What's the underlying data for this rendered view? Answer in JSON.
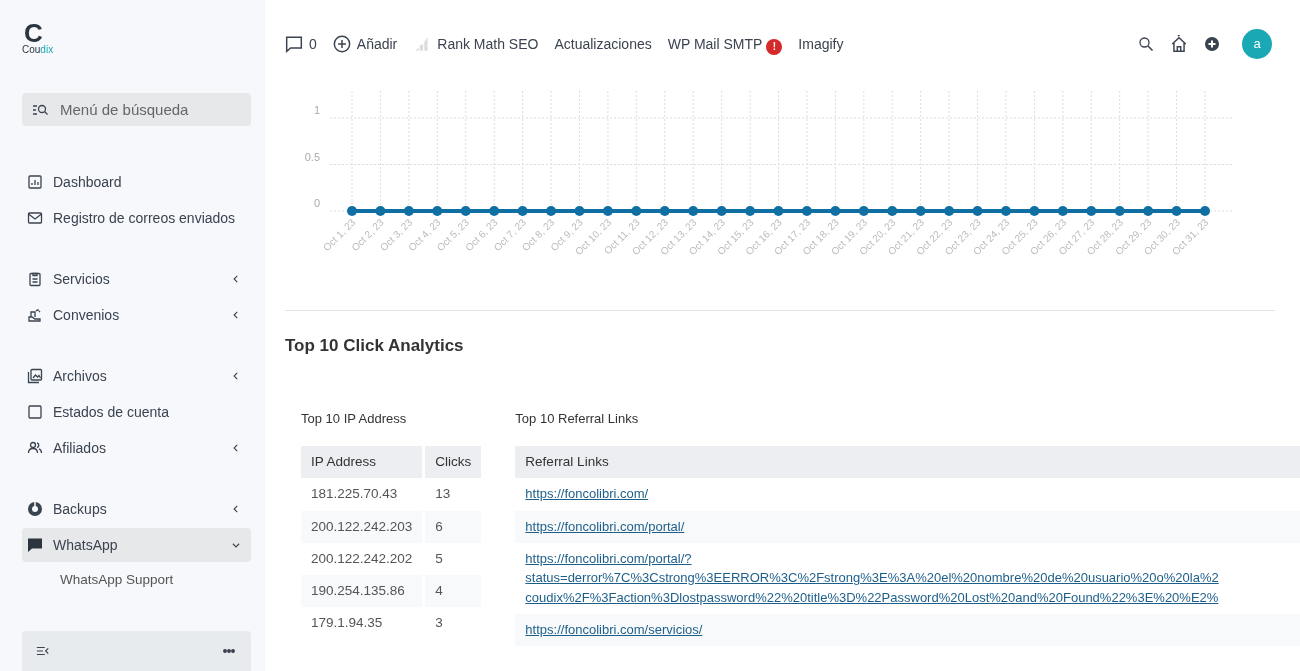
{
  "sidebar": {
    "logo": {
      "letter": "C",
      "wordmark_start": "Cou",
      "wordmark_end": "dix"
    },
    "search": {
      "placeholder": "Menú de búsqueda"
    },
    "groups": [
      [
        {
          "label": "Dashboard",
          "kind": "link",
          "selected": false
        },
        {
          "label": "Registro de correos enviados",
          "kind": "link",
          "selected": false
        }
      ],
      [
        {
          "label": "Servicios",
          "kind": "menu",
          "expanded": false,
          "selected": false
        },
        {
          "label": "Convenios",
          "kind": "menu",
          "expanded": false,
          "selected": false
        }
      ],
      [
        {
          "label": "Archivos",
          "kind": "menu",
          "expanded": false,
          "selected": false
        },
        {
          "label": "Estados de cuenta",
          "kind": "link",
          "selected": false
        },
        {
          "label": "Afiliados",
          "kind": "menu",
          "expanded": false,
          "selected": false
        }
      ],
      [
        {
          "label": "Backups",
          "kind": "menu",
          "expanded": false,
          "selected": false
        },
        {
          "label": "WhatsApp",
          "kind": "menu",
          "expanded": true,
          "selected": true,
          "children": [
            {
              "label": "WhatsApp Support"
            }
          ]
        }
      ]
    ]
  },
  "topbar": {
    "items": [
      {
        "kind": "comments",
        "label": "0"
      },
      {
        "kind": "add",
        "label": "Añadir"
      },
      {
        "kind": "seo",
        "label": "Rank Math SEO"
      },
      {
        "kind": "plain",
        "label": "Actualizaciones"
      },
      {
        "kind": "alert",
        "label": "WP Mail SMTP",
        "badge": "!"
      },
      {
        "kind": "plain",
        "label": "Imagify"
      }
    ],
    "avatar": "a"
  },
  "chart": {
    "chart_data": {
      "type": "line",
      "categories": [
        "Oct 1, 23",
        "Oct 2, 23",
        "Oct 3, 23",
        "Oct 4, 23",
        "Oct 5, 23",
        "Oct 6, 23",
        "Oct 7, 23",
        "Oct 8, 23",
        "Oct 9, 23",
        "Oct 10, 23",
        "Oct 11, 23",
        "Oct 12, 23",
        "Oct 13, 23",
        "Oct 14, 23",
        "Oct 15, 23",
        "Oct 16, 23",
        "Oct 17, 23",
        "Oct 18, 23",
        "Oct 19, 23",
        "Oct 20, 23",
        "Oct 21, 23",
        "Oct 22, 23",
        "Oct 23, 23",
        "Oct 24, 23",
        "Oct 25, 23",
        "Oct 26, 23",
        "Oct 27, 23",
        "Oct 28, 23",
        "Oct 29, 23",
        "Oct 30, 23",
        "Oct 31, 23"
      ],
      "grid": true,
      "series": [
        {
          "color": "#0f6fa3",
          "marker": true,
          "values": [
            0,
            0,
            0,
            0,
            0,
            0,
            0,
            0,
            0,
            0,
            0,
            0,
            0,
            0,
            0,
            0,
            0,
            0,
            0,
            0,
            0,
            0,
            0,
            0,
            0,
            0,
            0,
            0,
            0,
            0,
            0
          ]
        }
      ],
      "ylim": [
        0,
        1
      ],
      "yticks": [
        0,
        {
          "value": 0.5,
          "label": "0.5"
        },
        1
      ]
    }
  },
  "analytics": {
    "title": "Top 10 Click Analytics",
    "ip_table": {
      "title": "Top 10 IP Address",
      "columns": [
        "IP Address",
        "Clicks"
      ],
      "rows": [
        [
          "181.225.70.43",
          "13"
        ],
        [
          "200.122.242.203",
          "6"
        ],
        [
          "200.122.242.202",
          "5"
        ],
        [
          "190.254.135.86",
          "4"
        ],
        [
          "179.1.94.35",
          "3"
        ]
      ]
    },
    "referral_table": {
      "title": "Top 10 Referral Links",
      "columns": [
        "Referral Links"
      ],
      "rows": [
        {
          "lines": [
            "https://foncolibri.com/"
          ]
        },
        {
          "lines": [
            "https://foncolibri.com/portal/"
          ]
        },
        {
          "lines": [
            "https://foncolibri.com/portal/?",
            "status=derror%7C%3Cstrong%3EERROR%3C%2Fstrong%3E%3A%20el%20nombre%20de%20usuario%20o%20la%2",
            "coudix%2F%3Faction%3Dlostpassword%22%20title%3D%22Password%20Lost%20and%20Found%22%3E%20%E2%"
          ]
        },
        {
          "lines": [
            "https://foncolibri.com/servicios/"
          ]
        }
      ]
    }
  }
}
